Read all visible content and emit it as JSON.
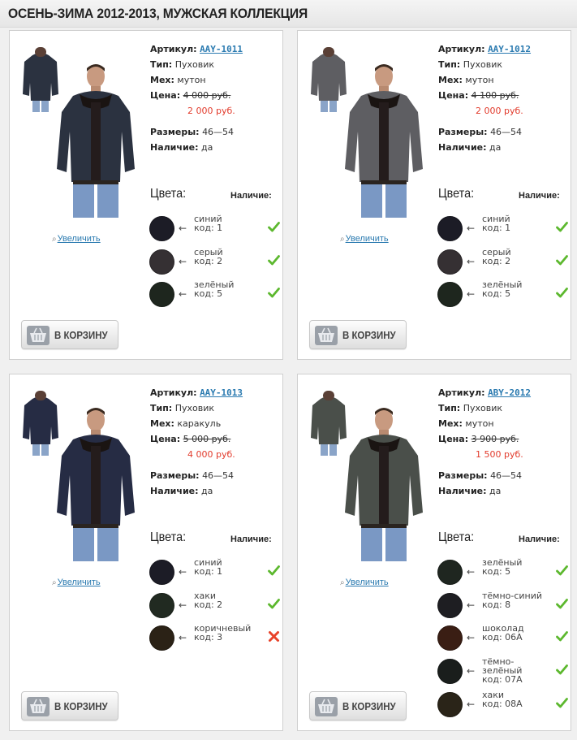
{
  "page_title": "ОСЕНЬ-ЗИМА 2012-2013, МУЖСКАЯ КОЛЛЕКЦИЯ",
  "labels": {
    "article": "Артикул:",
    "type": "Тип:",
    "fur": "Мех:",
    "price": "Цена:",
    "sizes": "Размеры:",
    "availability": "Наличие:",
    "colors": "Цвета:",
    "availability_col": "Наличие:",
    "zoom": "Увеличить",
    "cart": "В КОРЗИНУ",
    "arrow": "←"
  },
  "colors": {
    "sku_link": "#2a7ab0",
    "new_price": "#e23b2c",
    "check": "#5cb82e",
    "cross": "#e8432a"
  },
  "products": [
    {
      "sku": "AAY-1011",
      "type": "Пуховик",
      "fur": "мутон",
      "old_price": "4 000 руб.",
      "new_price": "2 000 руб.",
      "sizes": "46—54",
      "availability": "да",
      "jacket_color": "#2b3240",
      "swatches": [
        {
          "name": "синий",
          "code": "код: 1",
          "hex": "#1c1c26",
          "available": true
        },
        {
          "name": "серый",
          "code": "код: 2",
          "hex": "#353033",
          "available": true
        },
        {
          "name": "зелёный",
          "code": "код: 5",
          "hex": "#1e261e",
          "available": true
        }
      ]
    },
    {
      "sku": "AAY-1012",
      "type": "Пуховик",
      "fur": "мутон",
      "old_price": "4 100 руб.",
      "new_price": "2 000 руб.",
      "sizes": "46—54",
      "availability": "да",
      "jacket_color": "#5e5e62",
      "swatches": [
        {
          "name": "синий",
          "code": "код: 1",
          "hex": "#1c1c26",
          "available": true
        },
        {
          "name": "серый",
          "code": "код: 2",
          "hex": "#353033",
          "available": true
        },
        {
          "name": "зелёный",
          "code": "код: 5",
          "hex": "#1e261e",
          "available": true
        }
      ]
    },
    {
      "sku": "AAY-1013",
      "type": "Пуховик",
      "fur": "каракуль",
      "old_price": "5 000 руб.",
      "new_price": "4 000 руб.",
      "sizes": "46—54",
      "availability": "да",
      "jacket_color": "#262c44",
      "swatches": [
        {
          "name": "синий",
          "code": "код: 1",
          "hex": "#1c1c26",
          "available": true
        },
        {
          "name": "хаки",
          "code": "код: 2",
          "hex": "#212a21",
          "available": true
        },
        {
          "name": "коричневый",
          "code": "код: 3",
          "hex": "#2b2216",
          "available": false
        }
      ]
    },
    {
      "sku": "ABY-2012",
      "type": "Пуховик",
      "fur": "мутон",
      "old_price": "3 900 руб.",
      "new_price": "1 500 руб.",
      "sizes": "46—54",
      "availability": "да",
      "jacket_color": "#4a4f4a",
      "swatches": [
        {
          "name": "зелёный",
          "code": "код: 5",
          "hex": "#1f2620",
          "available": true
        },
        {
          "name": "тёмно-синий",
          "code": "код: 8",
          "hex": "#1e1e22",
          "available": true
        },
        {
          "name": "шоколад",
          "code": "код: 06A",
          "hex": "#3a1e14",
          "available": true
        },
        {
          "name": "тёмно-зелёный",
          "code": "код: 07A",
          "hex": "#1a1e1c",
          "available": true
        },
        {
          "name": "хаки",
          "code": "код: 08A",
          "hex": "#2a2418",
          "available": true
        }
      ]
    }
  ]
}
